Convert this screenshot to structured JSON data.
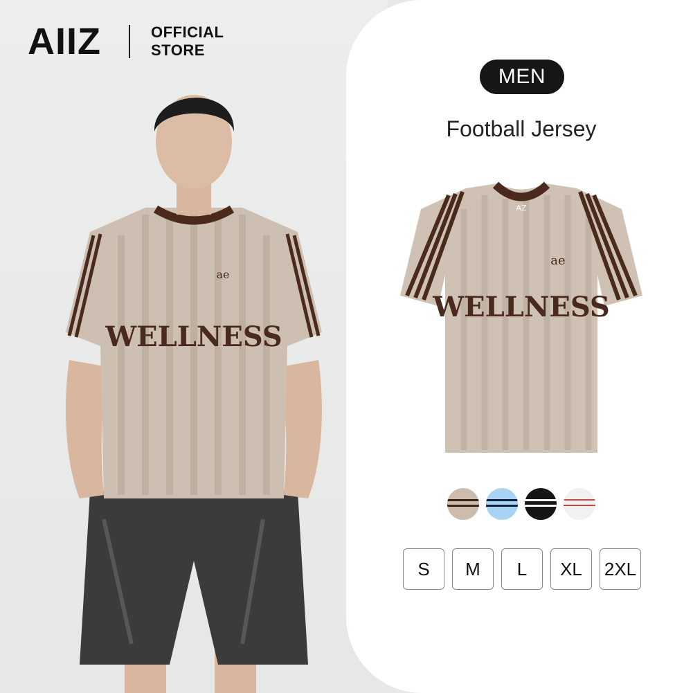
{
  "brand": {
    "logo_text": "AIIZ",
    "store_line1": "OFFICIAL",
    "store_line2": "STORE"
  },
  "product": {
    "category": "MEN",
    "name": "Football Jersey",
    "print_text": "WELLNESS",
    "monogram": "ae",
    "collar_logo": "AZ"
  },
  "colors": {
    "beige": "#cfc1b3",
    "brown": "#4a2a1c",
    "swatches": [
      {
        "name": "beige",
        "base": "#cdbcae",
        "stripe": "#3d2418"
      },
      {
        "name": "light-blue",
        "base": "#a9d3f5",
        "stripe": "#10203a"
      },
      {
        "name": "black",
        "base": "#151515",
        "stripe": "#ffffff"
      },
      {
        "name": "white",
        "base": "#f1f1f1",
        "stripe": "#d2453a"
      }
    ]
  },
  "sizes": [
    "S",
    "M",
    "L",
    "XL",
    "2XL"
  ]
}
